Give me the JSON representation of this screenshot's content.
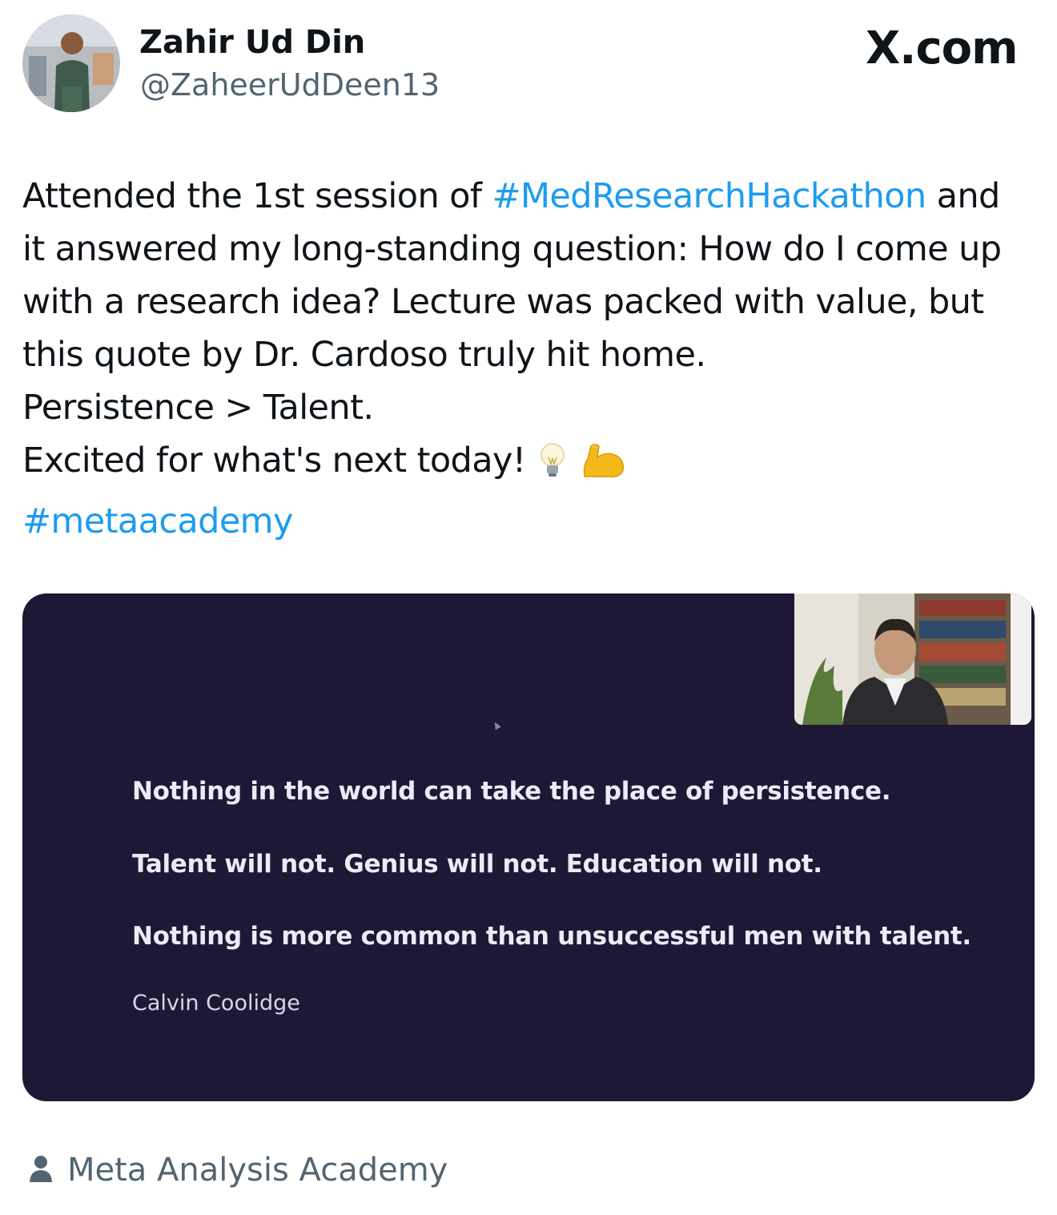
{
  "author": {
    "name": "Zahir Ud Din",
    "handle": "@ZaheerUdDeen13"
  },
  "brand": {
    "label": "X.com"
  },
  "post": {
    "line1_prefix": "Attended the 1st session of ",
    "line1_hashtag": "#MedResearchHackathon",
    "line1_suffix": " and",
    "line2": "it answered my long-standing question: How do I come up",
    "line3": "with a research idea? Lecture was packed with value, but",
    "line4": "this quote by Dr. Cardoso truly hit home.",
    "line5": "Persistence > Talent.",
    "line6": "Excited for what's next today!",
    "line6_emojis": [
      "light-bulb",
      "flexed-biceps"
    ],
    "hashtag2": "#metaacademy"
  },
  "slide": {
    "quote1": "Nothing in the world can take the place of persistence.",
    "quote2": "Talent will not. Genius will not. Education will not.",
    "quote3": "Nothing is more common than unsuccessful men with talent.",
    "attribution": "Calvin Coolidge",
    "background": "#1f1736"
  },
  "community": {
    "icon": "person-icon",
    "label": "Meta Analysis Academy"
  },
  "colors": {
    "hashtag": "#1d9bf0",
    "secondary_text": "#536471"
  }
}
